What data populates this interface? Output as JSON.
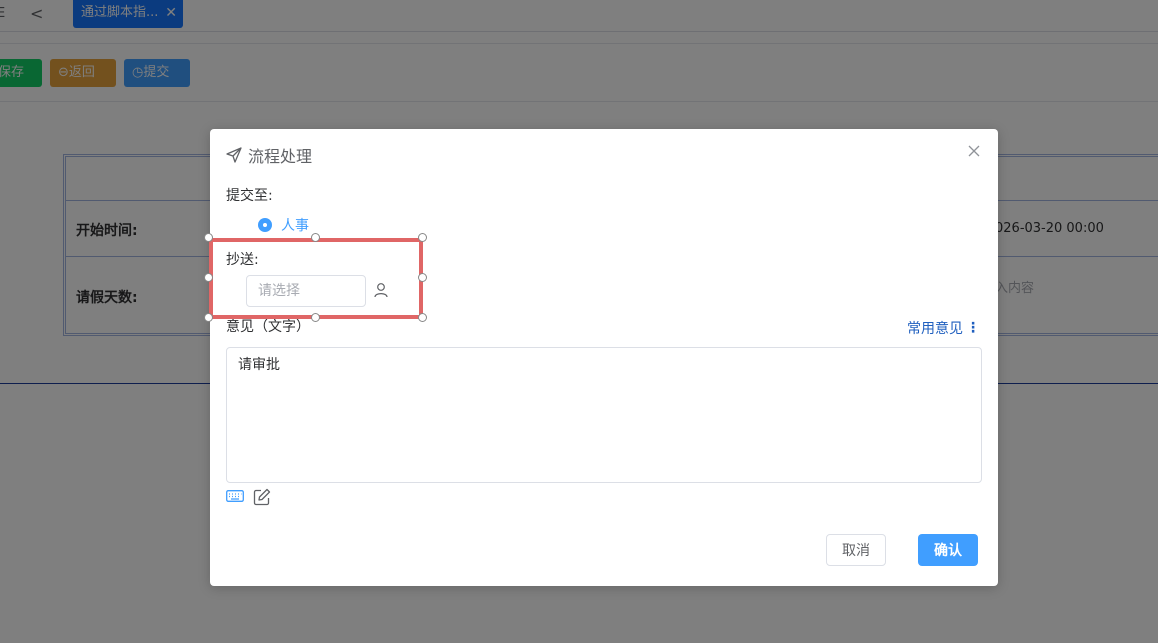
{
  "background": {
    "tab_truncated": "E",
    "back_glyph": "<",
    "active_tab": "通过脚本指...",
    "active_tab_close": "✕",
    "buttons": {
      "save": "保存",
      "back": "返回",
      "submit": "提交"
    },
    "form": {
      "start_time_label": "开始时间:",
      "leave_days_label": "请假天数:",
      "start_time_value": "026-03-20 00:00",
      "leave_days_placeholder": "入内容"
    }
  },
  "dialog": {
    "title": "流程处理",
    "submit_to_label": "提交至:",
    "submit_to_option": "人事",
    "cc_label": "抄送:",
    "cc_placeholder": "请选择",
    "opinion_label": "意见（文字）",
    "common_opinions": "常用意见",
    "opinion_text": "请审批",
    "cancel": "取消",
    "confirm": "确认"
  },
  "colors": {
    "primary": "#409eff",
    "annotation": "#e06666",
    "overlay": "rgba(0,0,0,0.5)"
  }
}
